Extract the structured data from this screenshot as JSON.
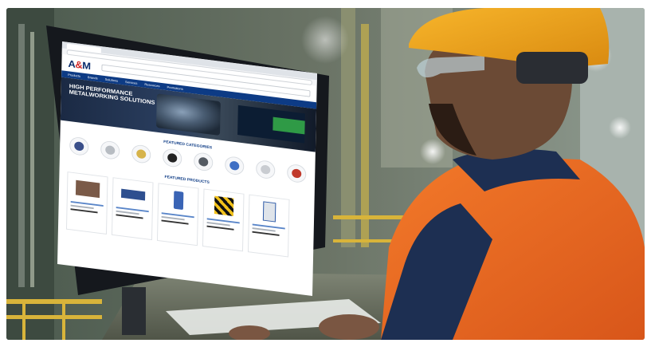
{
  "scene": {
    "subject": "worker-at-monitor"
  },
  "website": {
    "logo_text": "A",
    "logo_amp": "&",
    "logo_text_2": "M",
    "hero_title": "HIGH PERFORMANCE METALWORKING SOLUTIONS",
    "featured_categories_title": "FEATURED CATEGORIES",
    "featured_products_title": "FEATURED PRODUCTS",
    "nav_items": [
      "Products",
      "Brands",
      "Solutions",
      "Services",
      "Resources",
      "Promotions"
    ],
    "brand_color": "#0d3b85",
    "accent_color": "#d12a2a"
  },
  "colors": {
    "vest": "#f06a1c",
    "helmet": "#f2a51a",
    "jacket": "#1d2f52"
  }
}
